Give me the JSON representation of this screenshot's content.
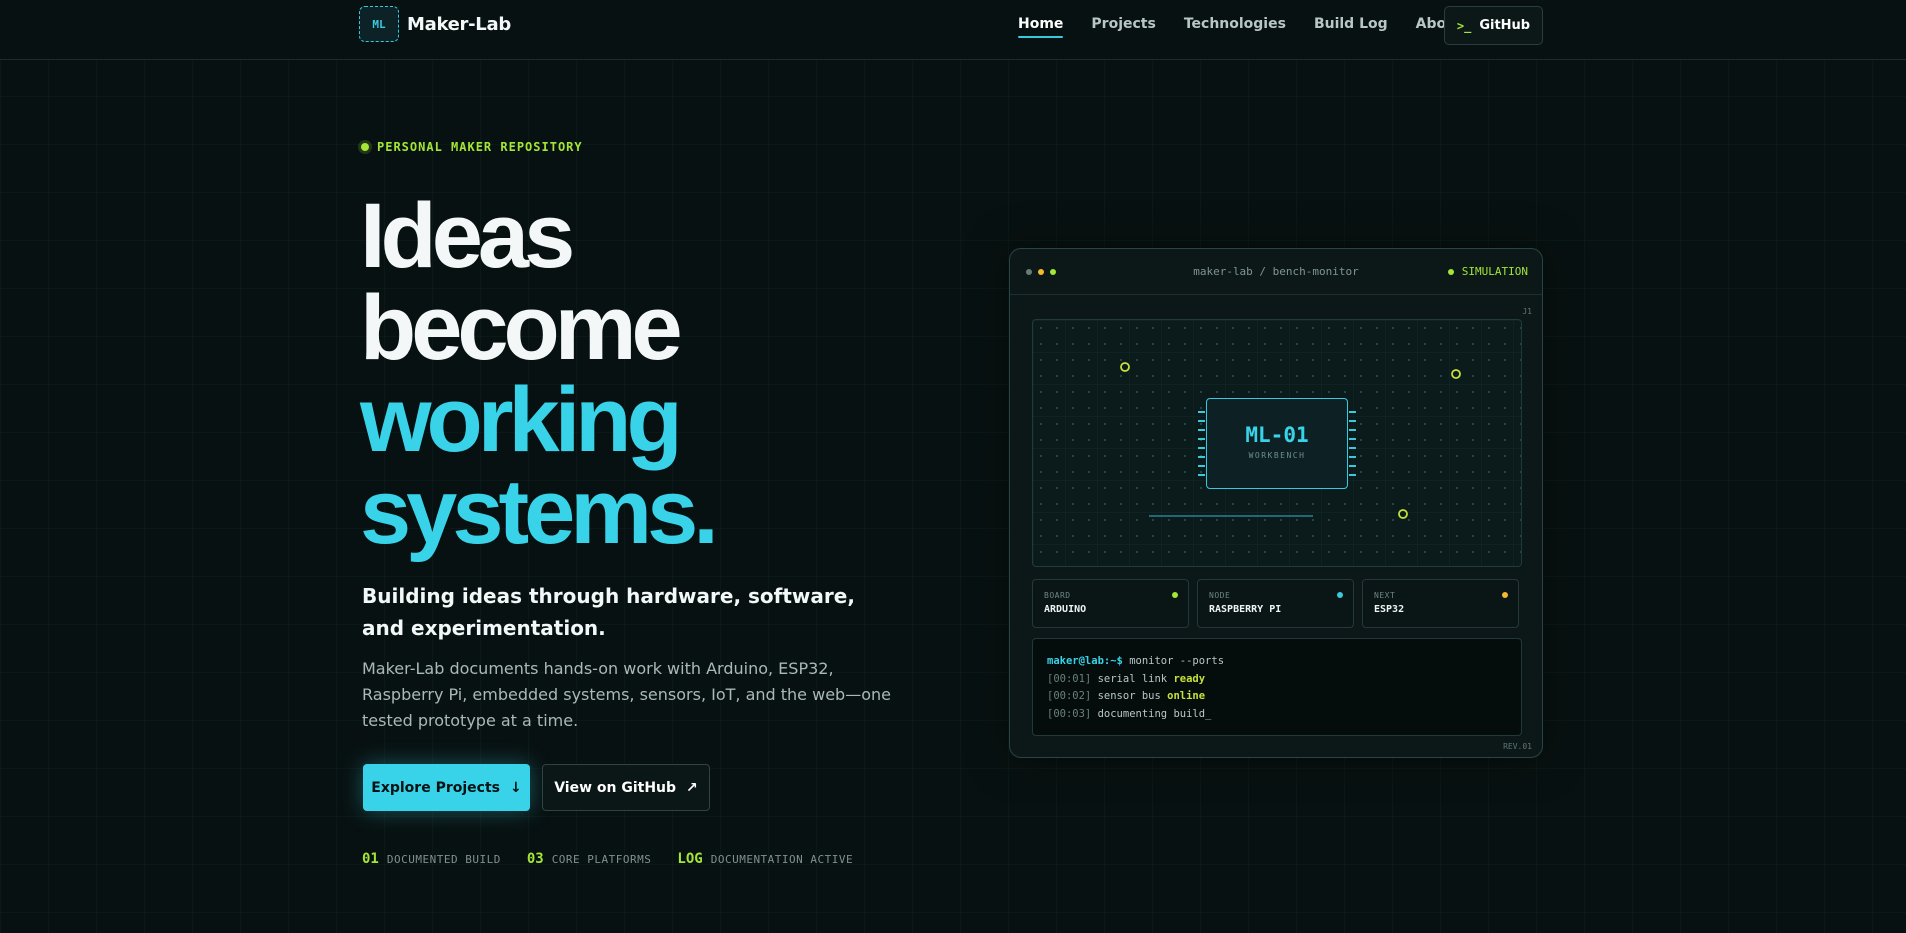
{
  "nav": {
    "logo_mark": "ML",
    "logo_text": "Maker-Lab",
    "links": [
      "Home",
      "Projects",
      "Technologies",
      "Build Log",
      "About"
    ],
    "active_link": "Home",
    "github_prompt": ">_",
    "github_label": "GitHub"
  },
  "hero": {
    "tag": "PERSONAL MAKER REPOSITORY",
    "headline": [
      "Ideas",
      "become",
      "working",
      "systems."
    ],
    "subhead": "Building ideas through hardware, software, and experimentation.",
    "description": "Maker-Lab documents hands-on work with Arduino, ESP32, Raspberry Pi, embedded systems, sensors, IoT, and the web—one tested prototype at a time.",
    "primary_button": "Explore Projects",
    "primary_button_icon": "↓",
    "secondary_button": "View on GitHub",
    "secondary_button_icon": "↗",
    "stats": [
      {
        "num": "01",
        "label": "DOCUMENTED BUILD"
      },
      {
        "num": "03",
        "label": "CORE PLATFORMS"
      },
      {
        "num": "LOG",
        "label": "DOCUMENTATION ACTIVE"
      }
    ]
  },
  "panel": {
    "title": "maker-lab / bench-monitor",
    "status": "SIMULATION",
    "corner_label": "J1",
    "chip_name": "ML-01",
    "chip_sub": "WORKBENCH",
    "cards": [
      {
        "key": "BOARD",
        "value": "ARDUINO",
        "dot_color": "#a3e635"
      },
      {
        "key": "NODE",
        "value": "RASPBERRY PI",
        "dot_color": "#38c9dd"
      },
      {
        "key": "NEXT",
        "value": "ESP32",
        "dot_color": "#f5b82e"
      }
    ],
    "terminal": {
      "prompt": "maker@lab:~$",
      "command": "monitor --ports",
      "lines": [
        {
          "ts": "[00:01]",
          "text": "serial link",
          "status": "ready"
        },
        {
          "ts": "[00:02]",
          "text": "sensor bus",
          "status": "online"
        },
        {
          "ts": "[00:03]",
          "text": "documenting build_",
          "status": ""
        }
      ]
    },
    "rev": "REV.01"
  },
  "colors": {
    "accent_cyan": "#38d3e8",
    "accent_lime": "#a3e635",
    "background": "#081111",
    "window_dots": [
      "#6b7b7b",
      "#f5b82e",
      "#a3e635"
    ]
  }
}
